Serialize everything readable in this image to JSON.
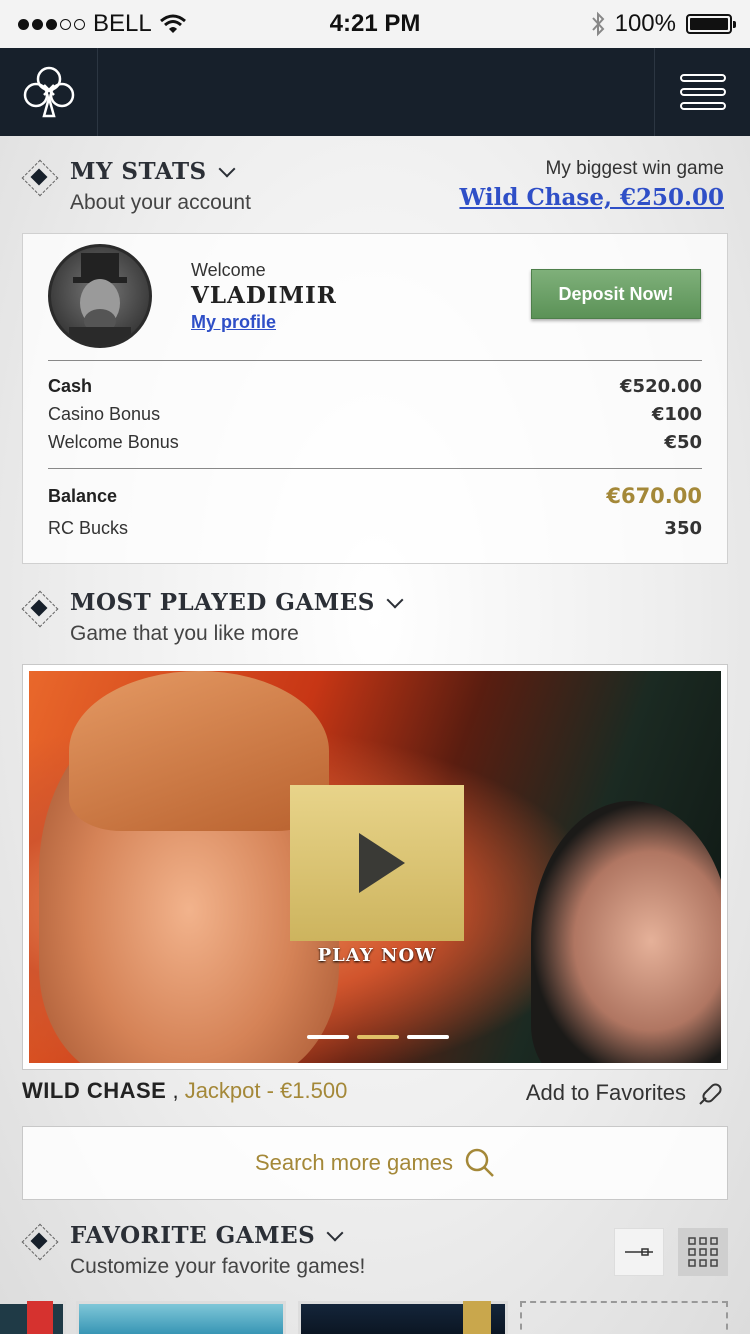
{
  "status_bar": {
    "carrier": "BELL",
    "time": "4:21 PM",
    "battery": "100%",
    "signal_bars_filled": 3,
    "signal_bars_total": 5
  },
  "header": {
    "logo_icon": "club-icon",
    "menu_icon": "hamburger-menu-icon",
    "background_color": "#17202b"
  },
  "my_stats": {
    "title": "MY STATS",
    "subtitle": "About your account",
    "biggest_win_label": "My biggest win game",
    "biggest_win_value": "Wild Chase, €250.00"
  },
  "account": {
    "welcome": "Welcome",
    "username": "VLADIMIR",
    "profile_link": "My profile",
    "deposit_button": "Deposit Now!",
    "rows": [
      {
        "label": "Cash",
        "value": "€520.00"
      },
      {
        "label": "Casino Bonus",
        "value": "€100"
      },
      {
        "label": "Welcome Bonus",
        "value": "€50"
      }
    ],
    "balance_label": "Balance",
    "balance_value": "€670.00",
    "rc_bucks_label": "RC Bucks",
    "rc_bucks_value": "350"
  },
  "most_played": {
    "title": "MOST PLAYED GAMES",
    "subtitle": "Game that you like more",
    "play_now": "PLAY NOW",
    "game_name": "WILD CHASE",
    "jackpot": "Jackpot - €1.500",
    "add_favorites": "Add to Favorites",
    "carousel_pages": 3,
    "carousel_active_index": 1
  },
  "search": {
    "placeholder": "Search more games"
  },
  "favorites": {
    "title": "FAVORITE GAMES",
    "subtitle": "Customize your favorite games!"
  },
  "colors": {
    "accent_gold": "#a48838",
    "link_blue": "#2f4fc7",
    "deposit_green": "#6ea26a",
    "dark_navy": "#17202b"
  }
}
